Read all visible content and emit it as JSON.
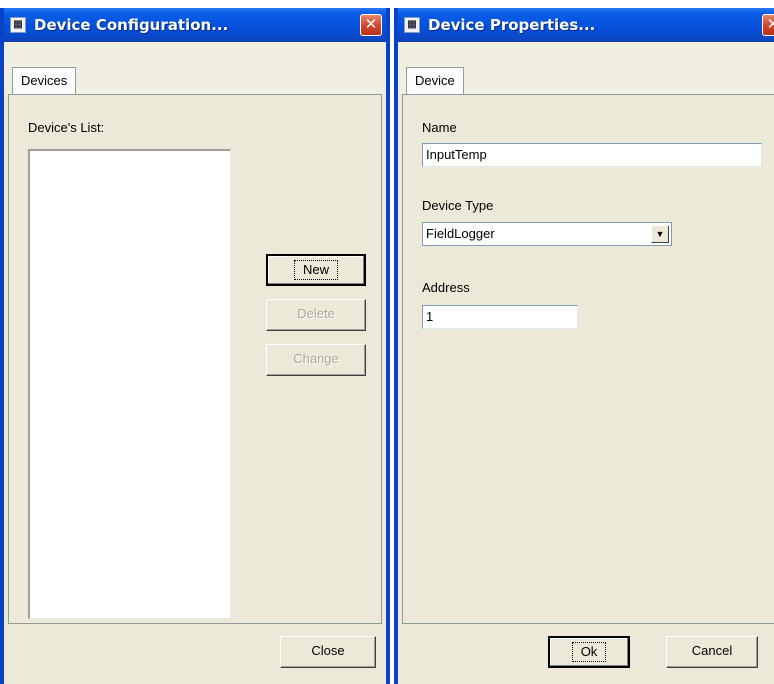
{
  "device_configuration": {
    "title": "Device Configuration...",
    "close_glyph": "✕",
    "tabs": [
      "Devices"
    ],
    "list_label": "Device's List:",
    "devices": [],
    "buttons": {
      "new": "New",
      "delete": "Delete",
      "change": "Change",
      "close": "Close"
    }
  },
  "device_properties": {
    "title": "Device Properties...",
    "close_glyph": "✕",
    "tabs": [
      "Device"
    ],
    "name_label": "Name",
    "name_value": "InputTemp",
    "device_type_label": "Device Type",
    "device_type_value": "FieldLogger",
    "address_label": "Address",
    "address_value": "1",
    "buttons": {
      "ok": "Ok",
      "cancel": "Cancel"
    }
  },
  "icons": {
    "app_icon": "app-icon",
    "close_icon": "close-icon",
    "dropdown_icon": "chevron-down-icon"
  },
  "colors": {
    "titlebar": "#0450dc",
    "window_border": "#0842c6",
    "dialog_face": "#ece9d8",
    "close_button": "#d2442a",
    "disabled_text": "#aca899"
  }
}
